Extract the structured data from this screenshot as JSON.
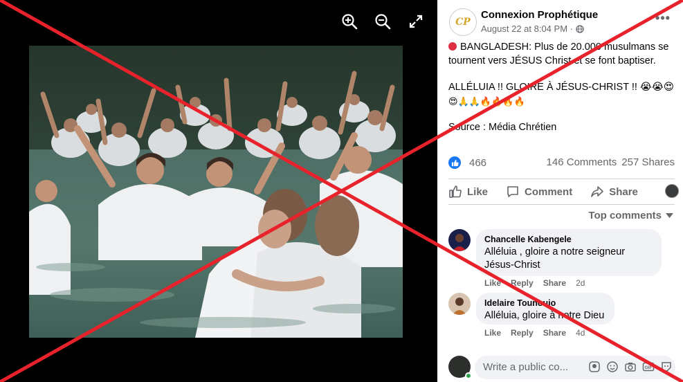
{
  "viewer": {
    "buttons": [
      {
        "icon": "zoom-in-icon"
      },
      {
        "icon": "zoom-out-icon"
      },
      {
        "icon": "fullscreen-icon"
      }
    ]
  },
  "post": {
    "page_name": "Connexion Prophétique",
    "avatar_initials": "CP",
    "meta": "August 22 at 8:04 PM ·",
    "privacy_icon": "globe-icon",
    "text_line1": "BANGLADESH: Plus de 20.000 musulmans se tournent vers JÉSUS Christ et se font baptiser.",
    "text_line2": "ALLÉLUIA !! GLOIRE À JÉSUS-CHRIST !! 😭😭😍",
    "text_line3": "😍🙏🙏🔥🔥🔥🔥",
    "text_line4": "Source : Média Chrétien",
    "reaction_count": "466",
    "comments_count": "146 Comments",
    "shares_count": "257 Shares"
  },
  "actions": {
    "like": "Like",
    "comment": "Comment",
    "share": "Share"
  },
  "comments_section": {
    "sort_label": "Top comments",
    "comments": [
      {
        "name": "Chancelle Kabengele",
        "text": "Alléluia , gloire a notre seigneur Jésus-Christ",
        "like": "Like",
        "reply": "Reply",
        "share": "Share",
        "time": "2d"
      },
      {
        "name": "Idelaire Tounouio",
        "text": "Alléluia, gloire à notre Dieu",
        "like": "Like",
        "reply": "Reply",
        "share": "Share",
        "time": "4d"
      }
    ],
    "composer_placeholder": "Write a public co..."
  },
  "colors": {
    "facebook_blue": "#1877f2",
    "cross_red": "#e8222b",
    "panel_bg": "#ffffff"
  }
}
